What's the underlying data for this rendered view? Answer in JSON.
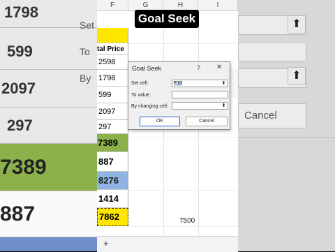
{
  "video_title": "Goal Seek",
  "background_left": {
    "values": [
      "1798",
      "599",
      "2097",
      "297",
      "7389",
      "887"
    ]
  },
  "background_right": {
    "cancel_label": "Cancel",
    "partial_labels": [
      "Set",
      "To",
      "By"
    ]
  },
  "sheet": {
    "columns": [
      "F",
      "G",
      "H",
      "I"
    ],
    "header_cell": "tal Price",
    "f_values": [
      "2598",
      "1798",
      "599",
      "2097",
      "297",
      "7389",
      "887",
      "8276",
      "1414",
      "7862"
    ],
    "h_value": "7500",
    "add_sheet": "+"
  },
  "goal_seek": {
    "title": "Goal Seek",
    "help": "?",
    "close": "✕",
    "set_cell_label": "Set cell:",
    "set_cell_value": "F10",
    "to_value_label": "To value:",
    "to_value_value": "",
    "by_changing_label": "By changing cell:",
    "by_changing_value": "",
    "ok_label": "OK",
    "cancel_label": "Cancel",
    "ref_icon": "⬆"
  },
  "colors": {
    "yellow": "#ffe600",
    "green": "#8db14a",
    "blue": "#8fb4e3",
    "ok_border": "#2a6bd8"
  }
}
